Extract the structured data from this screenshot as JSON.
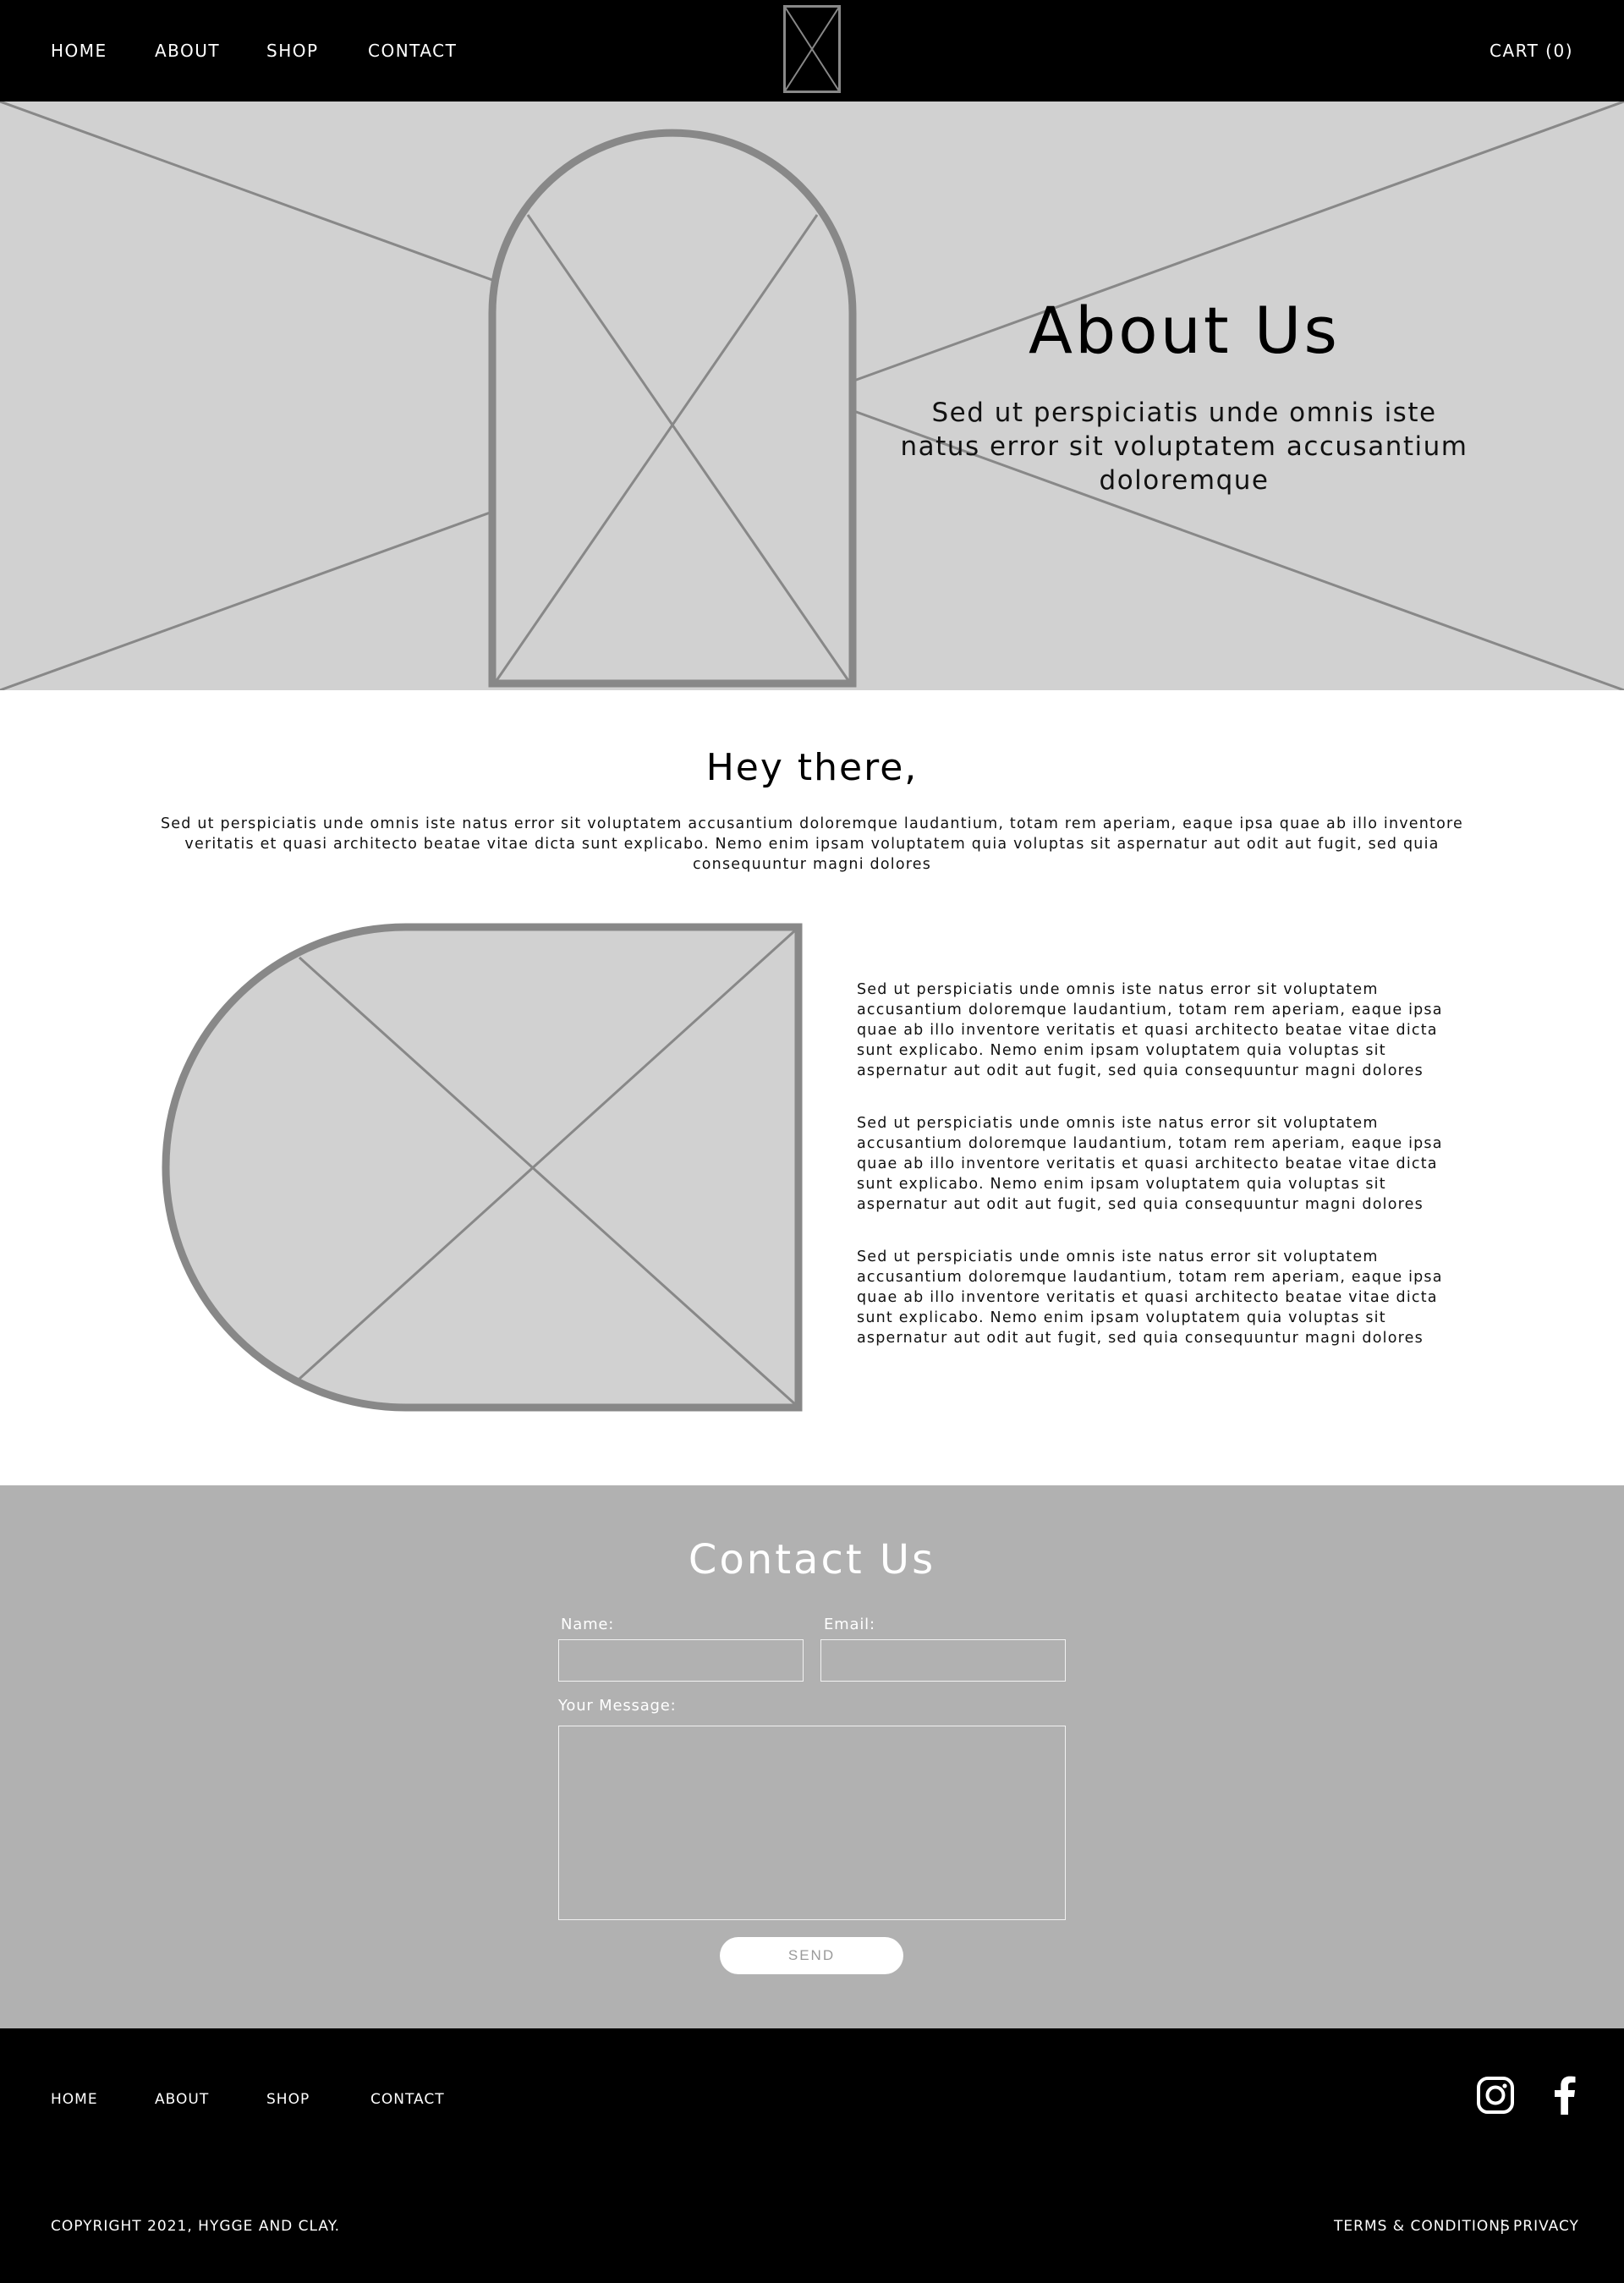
{
  "header": {
    "nav": [
      "HOME",
      "ABOUT",
      "SHOP",
      "CONTACT"
    ],
    "cart_label": "CART (0)"
  },
  "hero": {
    "title": "About Us",
    "subtitle": "Sed ut perspiciatis unde omnis iste natus error sit voluptatem accusantium doloremque"
  },
  "intro": {
    "heading": "Hey there,",
    "text": "Sed ut perspiciatis unde omnis iste natus error sit voluptatem accusantium doloremque laudantium, totam rem aperiam, eaque ipsa quae ab illo inventore veritatis et quasi architecto beatae vitae dicta sunt explicabo. Nemo enim ipsam voluptatem quia voluptas sit aspernatur aut odit aut fugit, sed quia consequuntur magni dolores"
  },
  "feature": {
    "paragraphs": [
      "Sed ut perspiciatis unde omnis iste natus error sit voluptatem accusantium doloremque laudantium, totam rem aperiam, eaque ipsa quae ab illo inventore veritatis et quasi architecto beatae vitae dicta sunt explicabo. Nemo enim ipsam voluptatem quia voluptas sit aspernatur aut odit aut fugit, sed quia consequuntur magni dolores",
      "Sed ut perspiciatis unde omnis iste natus error sit voluptatem accusantium doloremque laudantium, totam rem aperiam, eaque ipsa quae ab illo inventore veritatis et quasi architecto beatae vitae dicta sunt explicabo. Nemo enim ipsam voluptatem quia voluptas sit aspernatur aut odit aut fugit, sed quia consequuntur magni dolores",
      "Sed ut perspiciatis unde omnis iste natus error sit voluptatem accusantium doloremque laudantium, totam rem aperiam, eaque ipsa quae ab illo inventore veritatis et quasi architecto beatae vitae dicta sunt explicabo. Nemo enim ipsam voluptatem quia voluptas sit aspernatur aut odit aut fugit, sed quia consequuntur magni dolores"
    ]
  },
  "contact": {
    "title": "Contact Us",
    "name_label": "Name:",
    "email_label": "Email:",
    "message_label": "Your Message:",
    "send_label": "SEND"
  },
  "footer": {
    "nav": [
      "HOME",
      "ABOUT",
      "SHOP",
      "CONTACT"
    ],
    "copyright": "COPYRIGHT 2021, HYGGE AND CLAY.",
    "terms": "TERMS & CONDITIONS",
    "separator": "|",
    "privacy": "PRIVACY",
    "social_icons": [
      "instagram-icon",
      "facebook-icon"
    ]
  },
  "colors": {
    "header_bg": "#000000",
    "hero_bg": "#d1d1d1",
    "placeholder_stroke": "#888888",
    "contact_bg": "#b1b1b1",
    "footer_bg": "#000000"
  }
}
